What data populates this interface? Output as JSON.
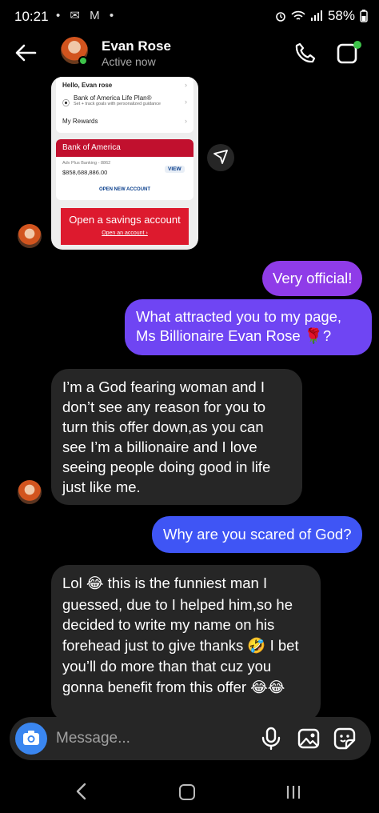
{
  "status_bar": {
    "time": "10:21",
    "battery": "58%",
    "left_icons": "• ✉ M •"
  },
  "header": {
    "name": "Evan Rose",
    "status": "Active now"
  },
  "shared_image": {
    "greeting": "Hello, Evan rose",
    "life_plan_title": "Bank of America Life Plan®",
    "life_plan_sub": "Set + track goals with personalized guidance",
    "rewards": "My Rewards",
    "bank_name": "Bank of America",
    "account_name": "Adv Plus Banking - 8862",
    "balance": "$858,688,886.00",
    "view_label": "VIEW",
    "open_account": "OPEN NEW ACCOUNT",
    "promo_title": "Open a savings account",
    "promo_link": "Open an account ›"
  },
  "messages": {
    "sent_1": "Very official!",
    "sent_2_line1": "What attracted you to my page,",
    "sent_2_line2": "Ms Billionaire Evan Rose ",
    "sent_2_emoji": "🌹",
    "sent_2_end": "?",
    "received_1": "I’m a God fearing woman and I don’t see any reason for you to turn this offer down,as you can see I’m a billionaire and I love seeing people doing good in life just like me.",
    "sent_3": "Why are you scared of God?",
    "received_2_a": "Lol ",
    "received_2_emoji1": "😂",
    "received_2_b": " this is the funniest man I guessed, due to I helped him,so he decided to write my name on his forehead just to give thanks ",
    "received_2_emoji2": "🤣",
    "received_2_c": " I bet you’ll do more than that cuz you gonna benefit from this offer ",
    "received_2_emoji3": "😂😂"
  },
  "composer": {
    "placeholder": "Message..."
  },
  "icons": {
    "back": "arrow-left-icon",
    "call": "phone-icon",
    "video": "video-camera-icon",
    "share": "send-icon",
    "camera": "camera-icon",
    "mic": "microphone-icon",
    "gallery": "image-icon",
    "sticker": "sticker-icon"
  },
  "colors": {
    "sent_purple": "#8f3ce8",
    "sent_violet": "#6f45f3",
    "sent_blue": "#3f55f5",
    "received": "#262626",
    "camera_blue": "#3a86f0",
    "boa_red": "#c1102e"
  }
}
